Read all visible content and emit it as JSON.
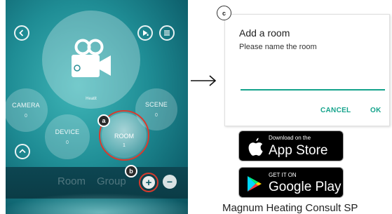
{
  "phone": {
    "circles": {
      "camera": {
        "label": "CAMERA",
        "count": "0"
      },
      "scene": {
        "label": "SCENE",
        "count": "0"
      },
      "device": {
        "label": "DEVICE",
        "count": "0"
      },
      "room": {
        "label": "ROOM",
        "count": "1"
      },
      "camera_caption": "Heatit"
    },
    "bottom_bar": {
      "room_label": "Room",
      "group_label": "Group"
    },
    "markers": {
      "a": "a",
      "b": "b"
    }
  },
  "dialog": {
    "marker": "c",
    "title": "Add a room",
    "subtitle": "Please name the room",
    "input_value": "",
    "cancel_label": "CANCEL",
    "ok_label": "OK"
  },
  "badges": {
    "app_store": {
      "small": "Download on the",
      "big": "App Store"
    },
    "google_play": {
      "small": "GET IT ON",
      "big": "Google Play"
    }
  },
  "caption": "Magnum Heating Consult SP",
  "colors": {
    "accent": "#14a38b",
    "highlight_ring": "#d83a2d",
    "teal_dark": "#0f6470"
  }
}
